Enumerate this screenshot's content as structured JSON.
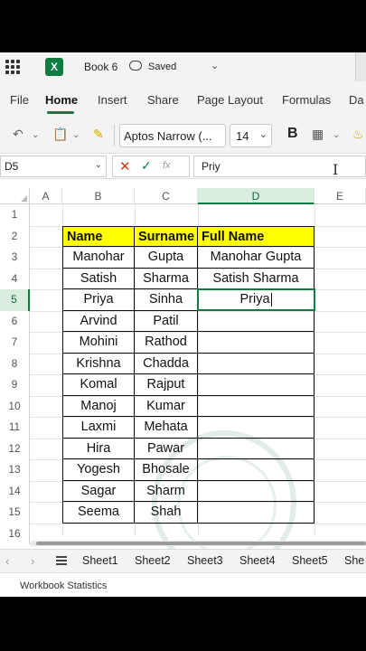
{
  "titlebar": {
    "book_name": "Book 6",
    "saved_label": "Saved",
    "logo": "X"
  },
  "ribbon_tabs": [
    "File",
    "Home",
    "Insert",
    "Share",
    "Page Layout",
    "Formulas",
    "Da"
  ],
  "toolbar": {
    "font_name": "Aptos Narrow (...",
    "font_size": "14",
    "bold_label": "B"
  },
  "formula_bar": {
    "name_box": "D5",
    "fx_label": "fx",
    "formula_value": "Priy"
  },
  "columns": [
    "A",
    "B",
    "C",
    "D",
    "E"
  ],
  "rows": [
    "1",
    "2",
    "3",
    "4",
    "5",
    "6",
    "7",
    "8",
    "9",
    "10",
    "11",
    "12",
    "13",
    "14",
    "15",
    "16"
  ],
  "table": {
    "headers": [
      "Name",
      "Surname",
      "Full Name"
    ],
    "rows": [
      [
        "Manohar",
        "Gupta",
        "Manohar Gupta"
      ],
      [
        "Satish",
        "Sharma",
        "Satish Sharma"
      ],
      [
        "Priya",
        "Sinha",
        "Priya"
      ],
      [
        "Arvind",
        "Patil",
        ""
      ],
      [
        "Mohini",
        "Rathod",
        ""
      ],
      [
        "Krishna",
        "Chadda",
        ""
      ],
      [
        "Komal",
        "Rajput",
        ""
      ],
      [
        "Manoj",
        "Kumar",
        ""
      ],
      [
        "Laxmi",
        "Mehata",
        ""
      ],
      [
        "Hira",
        "Pawar",
        ""
      ],
      [
        "Yogesh",
        "Bhosale",
        ""
      ],
      [
        "Sagar",
        "Sharm",
        ""
      ],
      [
        "Seema",
        "Shah",
        ""
      ]
    ]
  },
  "sheets": [
    "Sheet1",
    "Sheet2",
    "Sheet3",
    "Sheet4",
    "Sheet5",
    "She"
  ],
  "status_bar": {
    "text": "Workbook Statistics"
  },
  "colors": {
    "accent": "#107c41",
    "header_fill": "#ffff00"
  }
}
